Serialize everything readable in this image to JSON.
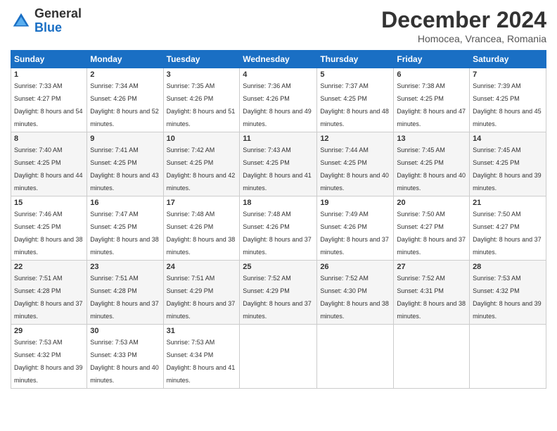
{
  "header": {
    "logo": {
      "general": "General",
      "blue": "Blue"
    },
    "title": "December 2024",
    "subtitle": "Homocea, Vrancea, Romania"
  },
  "calendar": {
    "days_of_week": [
      "Sunday",
      "Monday",
      "Tuesday",
      "Wednesday",
      "Thursday",
      "Friday",
      "Saturday"
    ],
    "weeks": [
      [
        {
          "day": "1",
          "sunrise": "7:33 AM",
          "sunset": "4:27 PM",
          "daylight": "8 hours and 54 minutes."
        },
        {
          "day": "2",
          "sunrise": "7:34 AM",
          "sunset": "4:26 PM",
          "daylight": "8 hours and 52 minutes."
        },
        {
          "day": "3",
          "sunrise": "7:35 AM",
          "sunset": "4:26 PM",
          "daylight": "8 hours and 51 minutes."
        },
        {
          "day": "4",
          "sunrise": "7:36 AM",
          "sunset": "4:26 PM",
          "daylight": "8 hours and 49 minutes."
        },
        {
          "day": "5",
          "sunrise": "7:37 AM",
          "sunset": "4:25 PM",
          "daylight": "8 hours and 48 minutes."
        },
        {
          "day": "6",
          "sunrise": "7:38 AM",
          "sunset": "4:25 PM",
          "daylight": "8 hours and 47 minutes."
        },
        {
          "day": "7",
          "sunrise": "7:39 AM",
          "sunset": "4:25 PM",
          "daylight": "8 hours and 45 minutes."
        }
      ],
      [
        {
          "day": "8",
          "sunrise": "7:40 AM",
          "sunset": "4:25 PM",
          "daylight": "8 hours and 44 minutes."
        },
        {
          "day": "9",
          "sunrise": "7:41 AM",
          "sunset": "4:25 PM",
          "daylight": "8 hours and 43 minutes."
        },
        {
          "day": "10",
          "sunrise": "7:42 AM",
          "sunset": "4:25 PM",
          "daylight": "8 hours and 42 minutes."
        },
        {
          "day": "11",
          "sunrise": "7:43 AM",
          "sunset": "4:25 PM",
          "daylight": "8 hours and 41 minutes."
        },
        {
          "day": "12",
          "sunrise": "7:44 AM",
          "sunset": "4:25 PM",
          "daylight": "8 hours and 40 minutes."
        },
        {
          "day": "13",
          "sunrise": "7:45 AM",
          "sunset": "4:25 PM",
          "daylight": "8 hours and 40 minutes."
        },
        {
          "day": "14",
          "sunrise": "7:45 AM",
          "sunset": "4:25 PM",
          "daylight": "8 hours and 39 minutes."
        }
      ],
      [
        {
          "day": "15",
          "sunrise": "7:46 AM",
          "sunset": "4:25 PM",
          "daylight": "8 hours and 38 minutes."
        },
        {
          "day": "16",
          "sunrise": "7:47 AM",
          "sunset": "4:25 PM",
          "daylight": "8 hours and 38 minutes."
        },
        {
          "day": "17",
          "sunrise": "7:48 AM",
          "sunset": "4:26 PM",
          "daylight": "8 hours and 38 minutes."
        },
        {
          "day": "18",
          "sunrise": "7:48 AM",
          "sunset": "4:26 PM",
          "daylight": "8 hours and 37 minutes."
        },
        {
          "day": "19",
          "sunrise": "7:49 AM",
          "sunset": "4:26 PM",
          "daylight": "8 hours and 37 minutes."
        },
        {
          "day": "20",
          "sunrise": "7:50 AM",
          "sunset": "4:27 PM",
          "daylight": "8 hours and 37 minutes."
        },
        {
          "day": "21",
          "sunrise": "7:50 AM",
          "sunset": "4:27 PM",
          "daylight": "8 hours and 37 minutes."
        }
      ],
      [
        {
          "day": "22",
          "sunrise": "7:51 AM",
          "sunset": "4:28 PM",
          "daylight": "8 hours and 37 minutes."
        },
        {
          "day": "23",
          "sunrise": "7:51 AM",
          "sunset": "4:28 PM",
          "daylight": "8 hours and 37 minutes."
        },
        {
          "day": "24",
          "sunrise": "7:51 AM",
          "sunset": "4:29 PM",
          "daylight": "8 hours and 37 minutes."
        },
        {
          "day": "25",
          "sunrise": "7:52 AM",
          "sunset": "4:29 PM",
          "daylight": "8 hours and 37 minutes."
        },
        {
          "day": "26",
          "sunrise": "7:52 AM",
          "sunset": "4:30 PM",
          "daylight": "8 hours and 38 minutes."
        },
        {
          "day": "27",
          "sunrise": "7:52 AM",
          "sunset": "4:31 PM",
          "daylight": "8 hours and 38 minutes."
        },
        {
          "day": "28",
          "sunrise": "7:53 AM",
          "sunset": "4:32 PM",
          "daylight": "8 hours and 39 minutes."
        }
      ],
      [
        {
          "day": "29",
          "sunrise": "7:53 AM",
          "sunset": "4:32 PM",
          "daylight": "8 hours and 39 minutes."
        },
        {
          "day": "30",
          "sunrise": "7:53 AM",
          "sunset": "4:33 PM",
          "daylight": "8 hours and 40 minutes."
        },
        {
          "day": "31",
          "sunrise": "7:53 AM",
          "sunset": "4:34 PM",
          "daylight": "8 hours and 41 minutes."
        },
        null,
        null,
        null,
        null
      ]
    ]
  }
}
